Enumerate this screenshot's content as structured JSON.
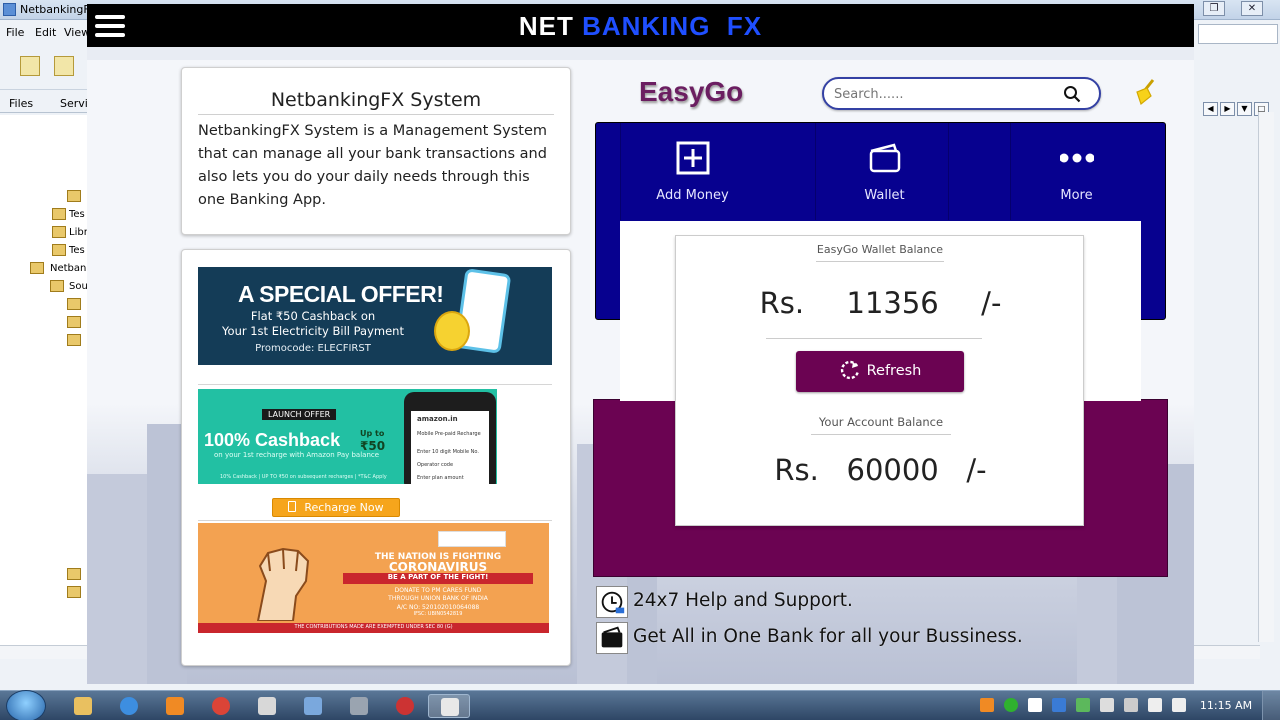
{
  "ide": {
    "title": "NetbankingF",
    "menu": [
      "File",
      "Edit",
      "View"
    ],
    "tabs": [
      "Files",
      "Servi"
    ],
    "tree": [
      "Tes",
      "Libr",
      "Tes",
      "Netbank",
      "Sou"
    ]
  },
  "app": {
    "title_part1": "NET",
    "title_part2": "BANKING",
    "title_part3": "FX"
  },
  "info_card": {
    "title": "NetbankingFX System",
    "text": "NetbankingFX System is a Management System that can manage all your bank transactions and also lets you do your daily needs through this one Banking App."
  },
  "offers": {
    "banner1": {
      "headline": "A SPECIAL OFFER!",
      "line1": "Flat ₹50 Cashback on",
      "line2": "Your 1st Electricity Bill Payment",
      "line3": "Promocode: ELECFIRST"
    },
    "banner2": {
      "tag": "LAUNCH OFFER",
      "headline": "100% Cashback",
      "upto": "Up to",
      "amount": "₹50",
      "sub": "on your 1st recharge with Amazon Pay balance",
      "fine": "10% Cashback | UP TO ₹50 on subsequent recharges | *T&C Apply",
      "phone_brand": "amazon.in",
      "phone_title": "Mobile Pre-paid Recharge",
      "phone_field1": "Enter 10 digit Mobile No.",
      "phone_field2": "Operator code",
      "phone_field3": "Enter plan amount"
    },
    "recharge_button": "Recharge Now",
    "banner3": {
      "l1": "THE NATION IS FIGHTING",
      "l2": "CORONAVIRUS",
      "l3": "BE A PART OF THE FIGHT!",
      "l4": "DONATE TO PM CARES FUND",
      "l5": "THROUGH UNION BANK OF INDIA",
      "l6": "A/C NO: 520102010064088",
      "l7": "IFSC: UBIN0542819",
      "footer": "THE CONTRIBUTIONS MADE ARE EXEMPTED UNDER SEC 80 (G)"
    }
  },
  "brand": "EasyGo",
  "search": {
    "placeholder": "Search......"
  },
  "quick_actions": [
    {
      "label": "Add Money",
      "icon": "plus-square-icon"
    },
    {
      "label": "Wallet",
      "icon": "wallet-icon"
    },
    {
      "label": "More",
      "icon": "more-dots-icon"
    }
  ],
  "wallet": {
    "label": "EasyGo Wallet Balance",
    "amount": "Rs.  11356  /-"
  },
  "refresh_label": "Refresh",
  "account": {
    "label": "Your Account Balance",
    "amount": "Rs.   60000   /-"
  },
  "features": [
    {
      "text": "24x7 Help and Support.",
      "icon": "support-clock-icon"
    },
    {
      "text": "Get All in One Bank for all your Bussiness.",
      "icon": "wallet-card-icon"
    }
  ],
  "taskbar": {
    "clock": "11:15 AM"
  },
  "colors": {
    "header": "#000000",
    "title_blue": "#1f4fff",
    "navy": "#07018f",
    "plum": "#6b0352",
    "recharge": "#f6a51c"
  }
}
